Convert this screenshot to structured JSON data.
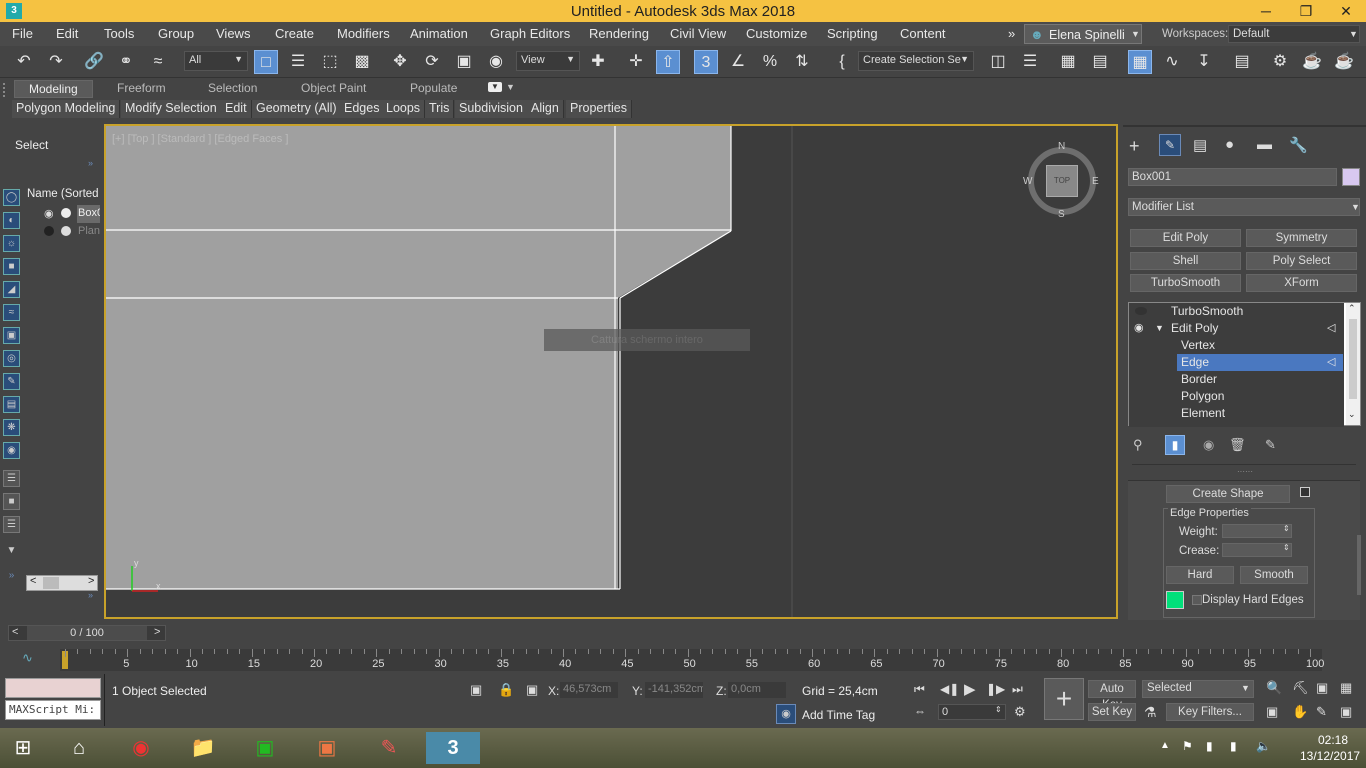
{
  "window": {
    "title": "Untitled - Autodesk 3ds Max 2018",
    "minimize": "─",
    "maximize": "❐",
    "close": "✕"
  },
  "menu": {
    "items": [
      "File",
      "Edit",
      "Tools",
      "Group",
      "Views",
      "Create",
      "Modifiers",
      "Animation",
      "Graph Editors",
      "Rendering",
      "Civil View",
      "Customize",
      "Scripting",
      "Content"
    ],
    "more": "»",
    "user": "Elena Spinelli",
    "workspaces_label": "Workspaces:",
    "workspace": "Default"
  },
  "toolbar": {
    "filter": "All",
    "ref_coord": "View",
    "selection_set": "Create Selection Se"
  },
  "ribbon": {
    "tabs": [
      "Modeling",
      "Freeform",
      "Selection",
      "Object Paint",
      "Populate"
    ],
    "buttons": [
      "Polygon Modeling",
      "Modify Selection",
      "Edit",
      "Geometry (All)",
      "Edges",
      "Loops",
      "Tris",
      "Subdivision",
      "Align",
      "Properties"
    ]
  },
  "scene_explorer": {
    "title": "Select",
    "column": "Name (Sorted A",
    "items": [
      "Box0",
      "Plan"
    ]
  },
  "viewport": {
    "label": "[+] [Top ] [Standard ] [Edged Faces ]",
    "overlay": "Cattura schermo intero",
    "viewcube": "TOP",
    "compass": {
      "n": "N",
      "s": "S",
      "e": "E",
      "w": "W"
    },
    "axis_y": "y",
    "axis_x": "x"
  },
  "command_panel": {
    "object_name": "Box001",
    "modifier_list": "Modifier List",
    "modifier_buttons": [
      "Edit Poly",
      "Symmetry",
      "Shell",
      "Poly Select",
      "TurboSmooth",
      "XForm"
    ],
    "stack": [
      "TurboSmooth",
      "Edit Poly",
      "Vertex",
      "Edge",
      "Border",
      "Polygon",
      "Element"
    ],
    "selected_stack": "Edge",
    "create_shape": "Create Shape",
    "edge_properties": "Edge Properties",
    "weight_label": "Weight:",
    "crease_label": "Crease:",
    "hard": "Hard",
    "smooth": "Smooth",
    "display_hard_edges": "Display Hard Edges",
    "color": "#d8c8f0",
    "edge_color": "#00e07a"
  },
  "timeline": {
    "frame": "0 / 100",
    "ticks": [
      "5",
      "10",
      "15",
      "20",
      "25",
      "30",
      "35",
      "40",
      "45",
      "50",
      "55",
      "60",
      "65",
      "70",
      "75",
      "80",
      "85",
      "90",
      "95",
      "100"
    ]
  },
  "status": {
    "selected": "1 Object Selected",
    "maxscript": "MAXScript Mi:",
    "x_label": "X:",
    "x": "46,573cm",
    "y_label": "Y:",
    "y": "-141,352cm",
    "z_label": "Z:",
    "z": "0,0cm",
    "grid": "Grid = 25,4cm",
    "add_time_tag": "Add Time Tag",
    "auto_key": "Auto Key",
    "set_key": "Set Key",
    "key_mode": "Selected",
    "key_filters": "Key Filters...",
    "frame_value": "0"
  },
  "taskbar": {
    "time": "02:18",
    "date": "13/12/2017"
  }
}
